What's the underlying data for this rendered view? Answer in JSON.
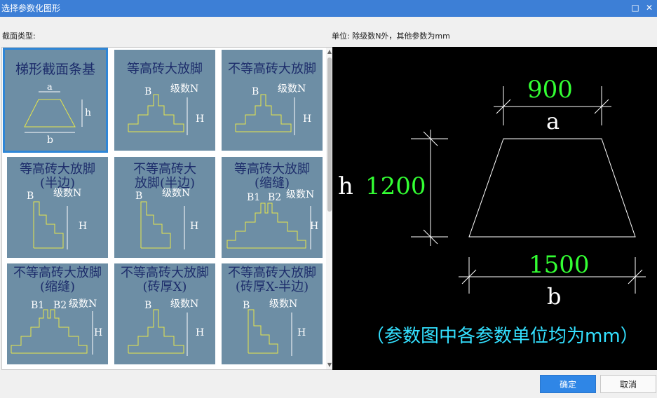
{
  "window": {
    "title": "选择参数化图形",
    "maximize_glyph": "□",
    "close_glyph": "✕"
  },
  "left_label": "截面类型:",
  "right_label": "单位:   除级数N外，其他参数为mm",
  "thumbnails": [
    {
      "title": "梯形截面条基",
      "labels": {
        "a": "a",
        "h": "h",
        "b": "b"
      }
    },
    {
      "title": "等高砖大放脚",
      "labels": {
        "B": "B",
        "N": "级数N",
        "H": "H"
      }
    },
    {
      "title": "不等高砖大放脚",
      "labels": {
        "B": "B",
        "N": "级数N",
        "H": "H"
      }
    },
    {
      "title": "等高砖大放脚\n(半边)",
      "labels": {
        "B": "B",
        "N": "级数N",
        "H": "H"
      }
    },
    {
      "title": "不等高砖大\n放脚(半边)",
      "labels": {
        "B": "B",
        "N": "级数N",
        "H": "H"
      }
    },
    {
      "title": "等高砖大放脚\n(缩缝)",
      "labels": {
        "B1": "B1",
        "B2": "B2",
        "N": "级数N",
        "H": "H"
      }
    },
    {
      "title": "不等高砖大放脚\n(缩缝)",
      "labels": {
        "B1": "B1",
        "B2": "B2",
        "N": "级数N",
        "H": "H"
      }
    },
    {
      "title": "不等高砖大放脚\n(砖厚X)",
      "labels": {
        "B": "B",
        "N": "级数N",
        "H": "H"
      }
    },
    {
      "title": "不等高砖大放脚\n(砖厚X-半边)",
      "labels": {
        "B": "B",
        "N": "级数N",
        "H": "H"
      }
    }
  ],
  "preview": {
    "a_value": "900",
    "a_label": "a",
    "h_label": "h",
    "h_value": "1200",
    "b_value": "1500",
    "b_label": "b",
    "note": "（参数图中各参数单位均为mm）",
    "colors": {
      "value": "#33ff33",
      "note": "#33e0ff",
      "line": "#ffffff"
    }
  },
  "buttons": {
    "ok": "确定",
    "cancel": "取消"
  },
  "scroll": {
    "up": "▲",
    "down": "▼"
  }
}
